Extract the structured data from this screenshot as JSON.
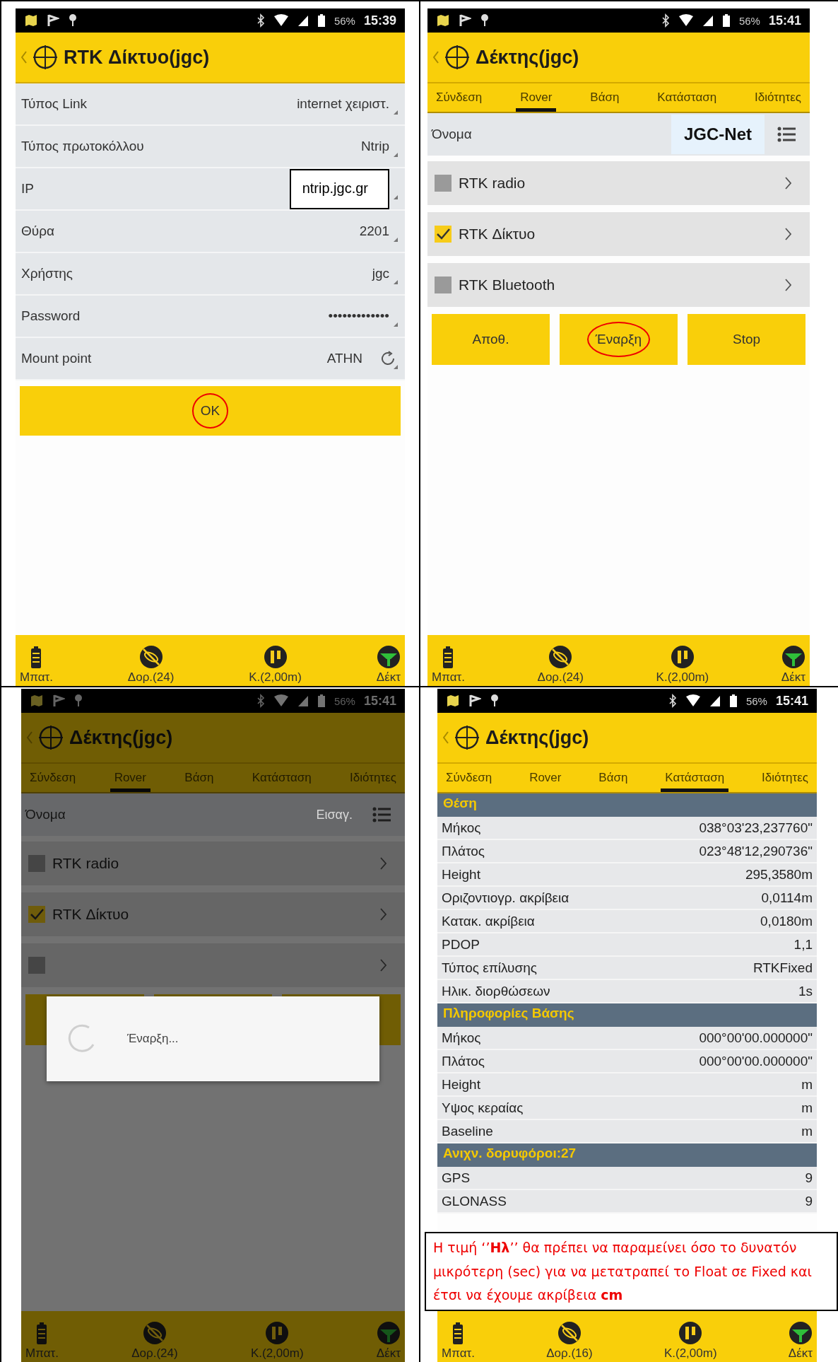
{
  "panels": [
    {
      "kind": "form",
      "dimmed": false,
      "status_bar": {
        "battery": "56%",
        "time": "15:39"
      },
      "title": "RTK Δίκτυο(jgc)",
      "fields": [
        {
          "label": "Τύπος Link",
          "value": "internet χειριστ.",
          "annotated": false,
          "refresh": false
        },
        {
          "label": "Τύπος πρωτοκόλλου",
          "value": "Ntrip",
          "annotated": false,
          "refresh": false
        },
        {
          "label": "IP",
          "value": "ntrip.jgc.gr",
          "annotated": true,
          "refresh": false
        },
        {
          "label": "Θύρα",
          "value": "2201",
          "annotated": false,
          "refresh": false
        },
        {
          "label": "Χρήστης",
          "value": "jgc",
          "annotated": false,
          "refresh": false
        },
        {
          "label": "Password",
          "value": "•••••••••••••",
          "annotated": false,
          "refresh": false
        },
        {
          "label": "Mount point",
          "value": "ATHN",
          "annotated": false,
          "refresh": true
        }
      ],
      "ok_button": {
        "label": "OK",
        "circled": true
      },
      "nav": [
        {
          "kind": "battery",
          "label": "Μπατ."
        },
        {
          "kind": "satellite",
          "label": "Δορ.(24)"
        },
        {
          "kind": "receiver",
          "label": "Κ.(2,00m)"
        },
        {
          "kind": "antenna",
          "label": "Δέκτ"
        }
      ]
    },
    {
      "kind": "rover",
      "dimmed": false,
      "status_bar": {
        "battery": "56%",
        "time": "15:41"
      },
      "title": "Δέκτης(jgc)",
      "tabs": [
        {
          "label": "Σύνδεση",
          "selected": false
        },
        {
          "label": "Rover",
          "selected": true
        },
        {
          "label": "Βάση",
          "selected": false
        },
        {
          "label": "Κατάσταση",
          "selected": false
        },
        {
          "label": "Ιδιότητες",
          "selected": false
        }
      ],
      "name_row": {
        "label": "Όνομα",
        "value": "JGC-Net"
      },
      "options": [
        {
          "label": "RTK radio",
          "checked": false
        },
        {
          "label": "RTK Δίκτυο",
          "checked": true
        },
        {
          "label": "RTK Bluetooth",
          "checked": false
        }
      ],
      "buttons": [
        {
          "label": "Αποθ.",
          "circled": false
        },
        {
          "label": "Έναρξη",
          "circled": true
        },
        {
          "label": "Stop",
          "circled": false
        }
      ],
      "nav": [
        {
          "kind": "battery",
          "label": "Μπατ."
        },
        {
          "kind": "satellite",
          "label": "Δορ.(24)"
        },
        {
          "kind": "receiver",
          "label": "Κ.(2,00m)"
        },
        {
          "kind": "antenna",
          "label": "Δέκτ"
        }
      ]
    },
    {
      "kind": "rover",
      "dimmed": true,
      "status_bar": {
        "battery": "56%",
        "time": "15:41"
      },
      "title": "Δέκτης(jgc)",
      "tabs": [
        {
          "label": "Σύνδεση",
          "selected": false
        },
        {
          "label": "Rover",
          "selected": true
        },
        {
          "label": "Βάση",
          "selected": false
        },
        {
          "label": "Κατάσταση",
          "selected": false
        },
        {
          "label": "Ιδιότητες",
          "selected": false
        }
      ],
      "name_row": {
        "label": "Όνομα",
        "placeholder": "Εισαγ."
      },
      "options": [
        {
          "label": "RTK radio",
          "checked": false
        },
        {
          "label": "RTK Δίκτυο",
          "checked": true
        },
        {
          "checked": false
        }
      ],
      "dialog": {
        "text": "Έναρξη..."
      },
      "nav": [
        {
          "kind": "battery",
          "label": "Μπατ."
        },
        {
          "kind": "satellite",
          "label": "Δορ.(24)"
        },
        {
          "kind": "receiver",
          "label": "Κ.(2,00m)"
        },
        {
          "kind": "antenna",
          "label": "Δέκτ"
        }
      ]
    },
    {
      "kind": "status",
      "dimmed": false,
      "status_bar": {
        "battery": "56%",
        "time": "15:41"
      },
      "title": "Δέκτης(jgc)",
      "tabs": [
        {
          "label": "Σύνδεση",
          "selected": false
        },
        {
          "label": "Rover",
          "selected": false
        },
        {
          "label": "Βάση",
          "selected": false
        },
        {
          "label": "Κατάσταση",
          "selected": true
        },
        {
          "label": "Ιδιότητες",
          "selected": false
        }
      ],
      "sections": [
        {
          "title": "Θέση",
          "rows": [
            {
              "label": "Μήκος",
              "value": "038°03'23,237760\""
            },
            {
              "label": "Πλάτος",
              "value": "023°48'12,290736\""
            },
            {
              "label": "Height",
              "value": "295,3580m"
            },
            {
              "label": "Οριζοντιογρ. ακρίβεια",
              "value": "0,0114m"
            },
            {
              "label": "Κατακ. ακρίβεια",
              "value": "0,0180m"
            },
            {
              "label": "PDOP",
              "value": "1,1"
            },
            {
              "label": "Τύπος επίλυσης",
              "value": "RTKFixed"
            },
            {
              "label": "Ηλικ. διορθώσεων",
              "value": "1s"
            }
          ]
        },
        {
          "title": "Πληροφορίες Βάσης",
          "rows": [
            {
              "label": "Μήκος",
              "value": "000°00'00.000000\""
            },
            {
              "label": "Πλάτος",
              "value": "000°00'00.000000\""
            },
            {
              "label": "Height",
              "value": "m"
            },
            {
              "label": "Υψος κεραίας",
              "value": "m"
            },
            {
              "label": "Baseline",
              "value": "m"
            }
          ]
        },
        {
          "title": "Ανιχν. δορυφόροι:27",
          "rows": [
            {
              "label": "GPS",
              "value": "9"
            },
            {
              "label": "GLONASS",
              "value": "9"
            }
          ]
        }
      ],
      "note": "Η τιμή ‘’**Ηλ**’’ θα πρέπει να παραμείνει όσο το δυνατόν μικρότερη (sec) για να μετατραπεί το Float σε Fixed και έτσι να έχουμε ακρίβεια **cm**",
      "nav": [
        {
          "kind": "battery",
          "label": "Μπατ."
        },
        {
          "kind": "satellite",
          "label": "Δορ.(16)"
        },
        {
          "kind": "receiver",
          "label": "Κ.(2,00m)"
        },
        {
          "kind": "antenna",
          "label": "Δέκτ"
        }
      ]
    }
  ]
}
